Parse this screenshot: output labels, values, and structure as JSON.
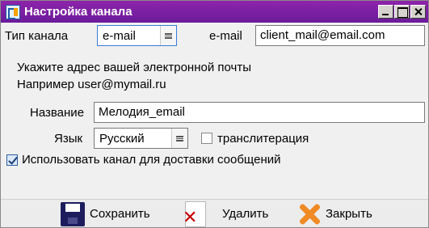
{
  "window": {
    "title": "Настройка канала"
  },
  "form": {
    "channel_type_label": "Тип канала",
    "channel_type_value": "e-mail",
    "email_label": "e-mail",
    "email_value": "client_mail@email.com",
    "hint_line1": "Укажите адрес вашей электронной почты",
    "hint_line2": "Например user@mymail.ru",
    "name_label": "Название",
    "name_value": "Мелодия_email",
    "language_label": "Язык",
    "language_value": "Русский",
    "transliteration_label": "транслитерация",
    "transliteration_checked": false,
    "use_channel_label": "Использовать канал для доставки сообщений",
    "use_channel_checked": true
  },
  "toolbar": {
    "save_label": "Сохранить",
    "delete_label": "Удалить",
    "close_label": "Закрыть"
  },
  "colors": {
    "titlebar": "#7b1fa2",
    "delete_icon": "#c40000",
    "close_icon": "#f08a24"
  },
  "icons": {
    "app": "app-icon",
    "save": "floppy-disk-icon",
    "delete": "delete-doc-icon",
    "close": "close-x-icon",
    "minimize": "minimize-icon",
    "maximize": "maximize-icon",
    "window_close": "window-close-icon"
  }
}
